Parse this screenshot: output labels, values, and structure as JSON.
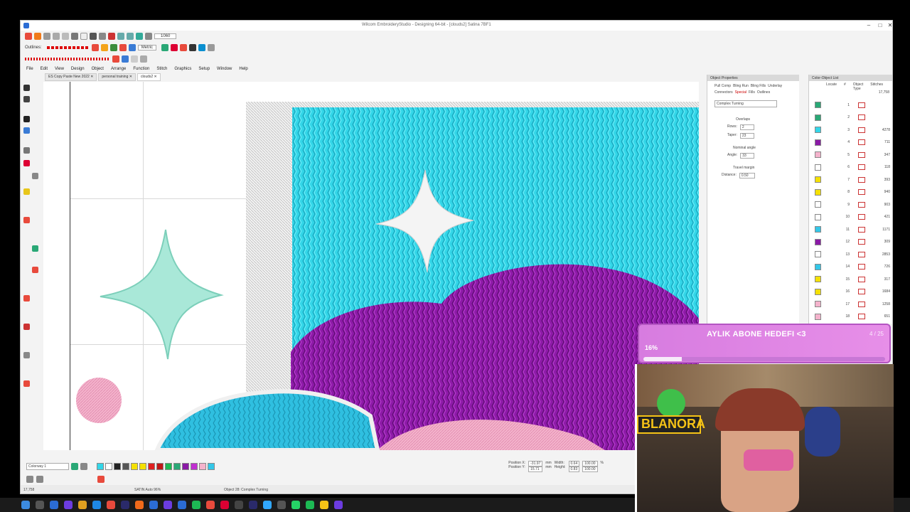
{
  "window": {
    "title": "Wilcom EmbroideryStudio - Designing 64-bit - [clouds2]   Satina 7BF1",
    "minimize": "–",
    "maximize": "□",
    "close": "✕"
  },
  "toolbar": {
    "outlines_label": "Outlines:",
    "zoom_value": "1060",
    "units_value": "Metric"
  },
  "menu": [
    "File",
    "Edit",
    "View",
    "Design",
    "Object",
    "Arrange",
    "Function",
    "Stitch",
    "Graphics",
    "Setup",
    "Window",
    "Help"
  ],
  "doc_tabs": [
    {
      "label": "ES Copy Paste New 2022 ✕"
    },
    {
      "label": "personal training ✕"
    },
    {
      "label": "clouds2 ✕"
    }
  ],
  "object_properties": {
    "header": "Object Properties",
    "tabs": [
      "Pull Comp",
      "Bling Run",
      "Bling Fills",
      "Underlay",
      "Connectors",
      "Special",
      "Fills",
      "Outlines"
    ],
    "fill_type": "Complex Turning",
    "overlaps_label": "Overlaps",
    "rows_label": "Rows:",
    "rows_value": "2",
    "taper_label": "Taper:",
    "taper_value": "23",
    "nominal_angle_label": "Nominal angle",
    "angle_label": "Angle:",
    "angle_value": "33",
    "travel_margin_label": "Travel margin",
    "distance_label": "Distance:",
    "distance_value": "0.50"
  },
  "color_object_list": {
    "header": "Color-Object List",
    "tabs": [
      "Locate",
      "#",
      "Object Type",
      "Stitches"
    ],
    "rows": [
      {
        "num": "1",
        "color": "#2aa876",
        "stitches": ""
      },
      {
        "num": "2",
        "color": "#2aa876",
        "stitches": ""
      },
      {
        "num": "3",
        "color": "#33d6e8",
        "stitches": "4278"
      },
      {
        "num": "4",
        "color": "#8a1aa6",
        "stitches": "711"
      },
      {
        "num": "5",
        "color": "#f4b3cc",
        "stitches": "347"
      },
      {
        "num": "6",
        "color": "#ffffff",
        "stitches": "118"
      },
      {
        "num": "7",
        "color": "#f5e100",
        "stitches": "393"
      },
      {
        "num": "8",
        "color": "#f5e100",
        "stitches": "940"
      },
      {
        "num": "9",
        "color": "#ffffff",
        "stitches": "903"
      },
      {
        "num": "10",
        "color": "#ffffff",
        "stitches": "421"
      },
      {
        "num": "11",
        "color": "#33c7e8",
        "stitches": "1171"
      },
      {
        "num": "12",
        "color": "#8a1aa6",
        "stitches": "309"
      },
      {
        "num": "13",
        "color": "#ffffff",
        "stitches": "2853"
      },
      {
        "num": "14",
        "color": "#33c7e8",
        "stitches": "726"
      },
      {
        "num": "15",
        "color": "#f5e100",
        "stitches": "317"
      },
      {
        "num": "16",
        "color": "#f5e100",
        "stitches": "1684"
      },
      {
        "num": "17",
        "color": "#f4b3cc",
        "stitches": "1258"
      },
      {
        "num": "18",
        "color": "#f4b3cc",
        "stitches": "651"
      }
    ],
    "total": "17,758"
  },
  "bottom": {
    "colorway": "Colorway 1",
    "position_x_label": "Position X:",
    "position_x": "-31.97",
    "position_y_label": "Position Y:",
    "position_y": "15.71",
    "width_label": "Width:",
    "width": "0.64",
    "height_label": "Height:",
    "height": "0.83",
    "unit": "mm",
    "scale_w": "100.00",
    "scale_h": "100.00",
    "pct": "%"
  },
  "status": {
    "stitch_count": "17,758",
    "mode": "SATIN Auto 96%",
    "object": "Object 28: Complex Turning"
  },
  "overlay": {
    "goal_title": "AYLIK ABONE HEDEFI <3",
    "goal_count": "4 / 25",
    "goal_percent": "16%",
    "goal_fraction": 0.16,
    "webcam_sign": "BLANORA"
  },
  "colors": {
    "cyan_fill": "#33d6e8",
    "purple_fill": "#8e1aa8",
    "white_star": "#f4f4f4",
    "mint_star": "#a9e8d8",
    "pink_dot": "#f2a8c3",
    "overlay_pink": "#d77ce0"
  }
}
